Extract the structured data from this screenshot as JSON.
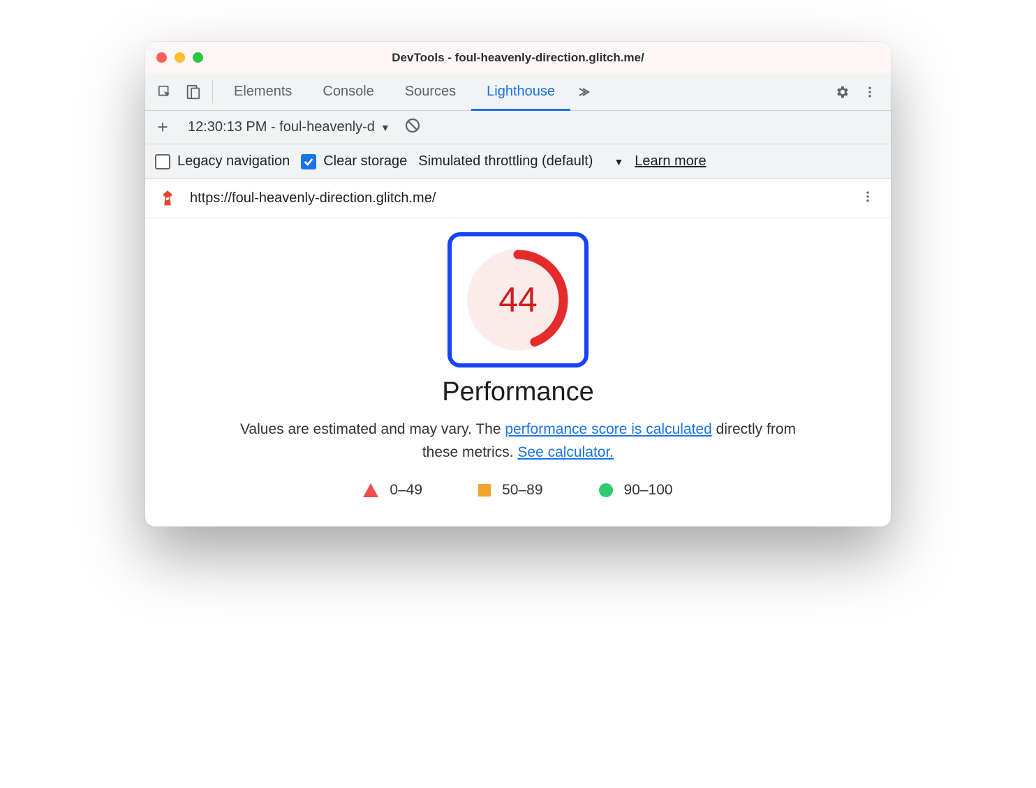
{
  "window": {
    "title": "DevTools - foul-heavenly-direction.glitch.me/"
  },
  "tabs": {
    "items": [
      "Elements",
      "Console",
      "Sources",
      "Lighthouse"
    ],
    "active_index": 3
  },
  "subbar": {
    "report_label": "12:30:13 PM - foul-heavenly-d"
  },
  "options": {
    "legacy_label": "Legacy navigation",
    "legacy_checked": false,
    "clear_storage_label": "Clear storage",
    "clear_storage_checked": true,
    "throttling_label": "Simulated throttling (default)",
    "learn_more_label": "Learn more"
  },
  "urlbar": {
    "url": "https://foul-heavenly-direction.glitch.me/"
  },
  "report": {
    "score": 44,
    "heading": "Performance",
    "desc_prefix": "Values are estimated and may vary. The ",
    "link1": "performance score is calculated",
    "desc_mid": " directly from these metrics. ",
    "link2": "See calculator.",
    "legend": {
      "poor": "0–49",
      "mid": "50–89",
      "good": "90–100"
    },
    "colors": {
      "poor": "#e42a2a",
      "mid": "#f0a429",
      "good": "#2ecc71"
    }
  }
}
